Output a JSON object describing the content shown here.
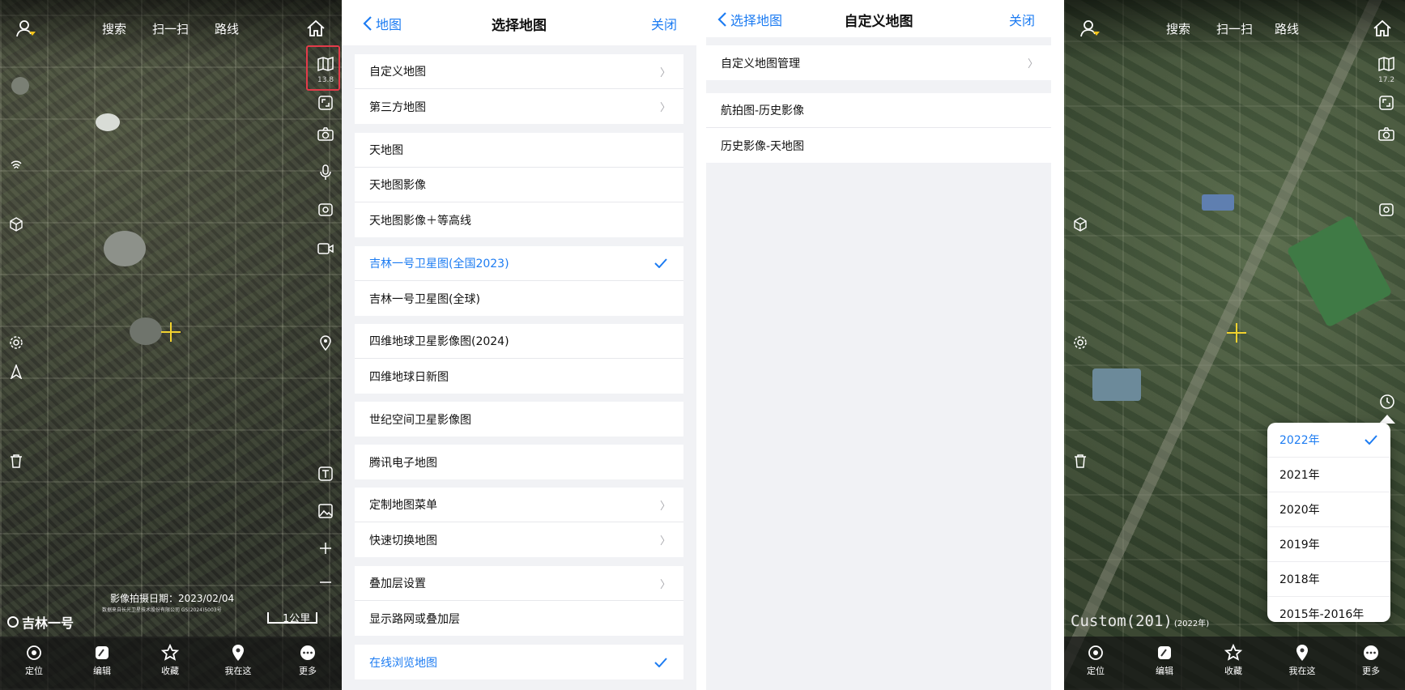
{
  "panel1": {
    "topbar": {
      "search": "搜索",
      "scan": "扫一扫",
      "route": "路线"
    },
    "zoom_level": "13.8",
    "capture_date": "影像拍摄日期：2023/02/04",
    "copyright": "数据来自长光卫星技术股份有限公司 GS(2024)5003号",
    "brand": "吉林一号",
    "scale": "1公里",
    "bottom_tabs": [
      "定位",
      "编辑",
      "收藏",
      "我在这",
      "更多"
    ]
  },
  "panel2": {
    "back": "地图",
    "title": "选择地图",
    "close": "关闭",
    "groups": [
      [
        {
          "label": "自定义地图",
          "chevron": true
        },
        {
          "label": "第三方地图",
          "chevron": true
        }
      ],
      [
        {
          "label": "天地图"
        },
        {
          "label": "天地图影像"
        },
        {
          "label": "天地图影像＋等高线"
        }
      ],
      [
        {
          "label": "吉林一号卫星图(全国2023)",
          "selected": true
        },
        {
          "label": "吉林一号卫星图(全球)"
        }
      ],
      [
        {
          "label": "四维地球卫星影像图(2024)"
        },
        {
          "label": "四维地球日新图"
        }
      ],
      [
        {
          "label": "世纪空间卫星影像图"
        }
      ],
      [
        {
          "label": "腾讯电子地图"
        }
      ],
      [
        {
          "label": "定制地图菜单",
          "chevron": true
        },
        {
          "label": "快速切换地图",
          "chevron": true
        }
      ],
      [
        {
          "label": "叠加层设置",
          "chevron": true
        },
        {
          "label": "显示路网或叠加层"
        }
      ],
      [
        {
          "label": "在线浏览地图",
          "selected": true
        }
      ]
    ]
  },
  "panel3": {
    "back": "选择地图",
    "title": "自定义地图",
    "close": "关闭",
    "groups": [
      [
        {
          "label": "自定义地图管理",
          "chevron": true
        }
      ],
      [
        {
          "label": "航拍图-历史影像"
        },
        {
          "label": "历史影像-天地图"
        }
      ]
    ]
  },
  "panel4": {
    "topbar": {
      "search": "搜索",
      "scan": "扫一扫",
      "route": "路线"
    },
    "zoom_level": "17.2",
    "watermark": "Custom(201)",
    "watermark_year": "(2022年)",
    "years": [
      {
        "label": "2022年",
        "selected": true
      },
      {
        "label": "2021年"
      },
      {
        "label": "2020年"
      },
      {
        "label": "2019年"
      },
      {
        "label": "2018年"
      },
      {
        "label": "2015年-2016年"
      }
    ],
    "bottom_tabs": [
      "定位",
      "编辑",
      "收藏",
      "我在这",
      "更多"
    ]
  },
  "colors": {
    "accent": "#1d7cf2",
    "highlight": "#e33b4a",
    "crosshair": "#f2d22e"
  }
}
